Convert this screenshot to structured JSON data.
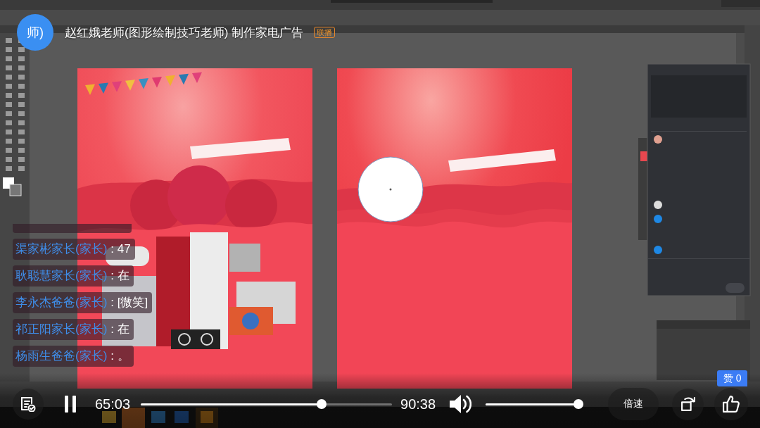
{
  "header": {
    "avatar_text": "师)",
    "title": "赵红娥老师(图形绘制技巧老师) 制作家电广告",
    "badge": "联播"
  },
  "chat": [
    {
      "name": "渠家彬家长(家长)",
      "text": ": 47"
    },
    {
      "name": "耿聪慧家长(家长)",
      "text": ": 在"
    },
    {
      "name": "李永杰爸爸(家长)",
      "text": ": [微笑]"
    },
    {
      "name": "祁正阳家长(家长)",
      "text": ": 在"
    },
    {
      "name": "杨雨生爸爸(家长)",
      "text": ": 。"
    }
  ],
  "player": {
    "playing": true,
    "current_time": "65:03",
    "progress": {
      "level": 0.72
    },
    "duration": "90:38",
    "volume": {
      "level": 1.0
    },
    "speed_label": "倍速",
    "like_badge": "赞 0"
  }
}
